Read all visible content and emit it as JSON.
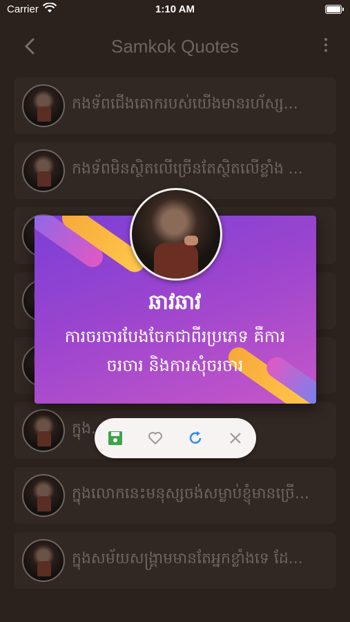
{
  "status_bar": {
    "carrier": "Carrier",
    "time": "1:10 AM"
  },
  "nav": {
    "title": "Samkok Quotes",
    "back_icon": "chevron-left-icon",
    "more_icon": "more-vertical-icon"
  },
  "quotes": [
    {
      "text": "កងទ័ពជើងគោករបស់យើងមានរហ័ស្ស..."
    },
    {
      "text": "កងទ័ពមិនស្ថិតលើច្រើនតែស្ថិតលើខ្លាំង ..."
    },
    {
      "text": ""
    },
    {
      "text": ""
    },
    {
      "text": ""
    },
    {
      "text": "ក្នុង...លាញ់គួនអ៊ី..."
    },
    {
      "text": "ក្នុងលោកនេះមនុស្សចង់សម្លាប់ខ្ញុំមានច្រើ..."
    },
    {
      "text": "ក្នុងសម័យសង្គ្រាមមានតែអ្នកខ្លាំងទេ ដែ..."
    }
  ],
  "dialog": {
    "name": "ឆាវឆាវ",
    "quote": "ការចរចារបែងចែកជាពីរប្រភេទ គឺការចរចារ និងការសុំចរចារ",
    "colors": {
      "gradient_start": "#7b3fd6",
      "gradient_end": "#c657c7",
      "accent_orange": "#f6a93a"
    }
  },
  "actions": {
    "save_icon": "save-icon",
    "favorite_icon": "heart-icon",
    "refresh_icon": "refresh-icon",
    "close_icon": "close-icon",
    "colors": {
      "save": "#3aa64a",
      "favorite": "#9a9a9a",
      "refresh": "#2f8be6",
      "close": "#9a9a9a"
    }
  }
}
